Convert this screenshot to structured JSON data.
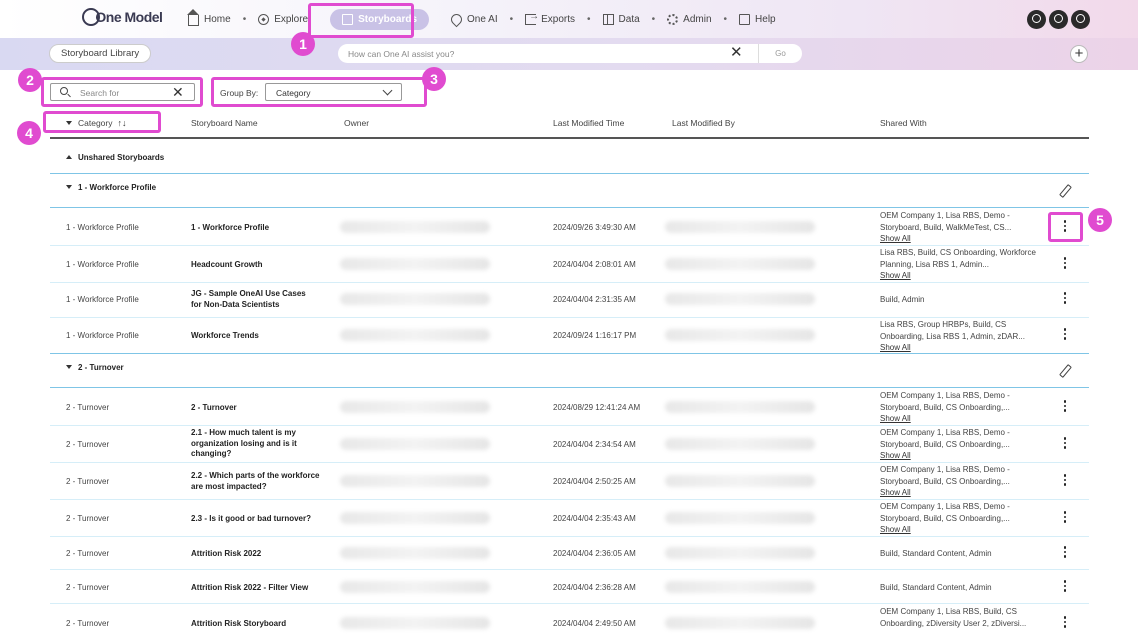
{
  "app": {
    "logo": "One Model"
  },
  "nav": [
    {
      "label": "Home",
      "icon": "home-icon"
    },
    {
      "label": "Explore",
      "icon": "compass-icon"
    },
    {
      "label": "Storyboards",
      "icon": "storyboard-icon",
      "active": true
    },
    {
      "label": "One AI",
      "icon": "pin-icon"
    },
    {
      "label": "Exports",
      "icon": "export-icon"
    },
    {
      "label": "Data",
      "icon": "data-icon"
    },
    {
      "label": "Admin",
      "icon": "gear-icon"
    },
    {
      "label": "Help",
      "icon": "help-icon"
    }
  ],
  "subbar": {
    "library_label": "Storyboard Library",
    "ai_placeholder": "How can One AI assist you?",
    "go_label": "Go"
  },
  "filters": {
    "search_placeholder": "Search for",
    "group_by_label": "Group By:",
    "group_by_value": "Category"
  },
  "columns": {
    "category": "Category",
    "name": "Storyboard Name",
    "owner": "Owner",
    "modified_time": "Last Modified Time",
    "modified_by": "Last Modified By",
    "shared_with": "Shared With"
  },
  "groups": {
    "unshared": "Unshared Storyboards",
    "workforce": "1 - Workforce Profile",
    "turnover": "2 - Turnover"
  },
  "show_all": "Show All",
  "rows": [
    {
      "category": "1 - Workforce Profile",
      "name": "1 - Workforce Profile",
      "time": "2024/09/26 3:49:30 AM",
      "shared": "OEM Company 1, Lisa RBS, Demo - Storyboard, Build, WalkMeTest, CS...",
      "show_all": true
    },
    {
      "category": "1 - Workforce Profile",
      "name": "Headcount Growth",
      "time": "2024/04/04 2:08:01 AM",
      "shared": "Lisa RBS, Build, CS Onboarding, Workforce Planning, Lisa RBS 1, Admin...",
      "show_all": true
    },
    {
      "category": "1 - Workforce Profile",
      "name": "JG - Sample OneAI Use Cases for Non-Data Scientists",
      "time": "2024/04/04 2:31:35 AM",
      "shared": "Build, Admin",
      "show_all": false
    },
    {
      "category": "1 - Workforce Profile",
      "name": "Workforce Trends",
      "time": "2024/09/24 1:16:17 PM",
      "shared": "Lisa RBS, Group HRBPs, Build, CS Onboarding, Lisa RBS 1, Admin, zDAR...",
      "show_all": true
    },
    {
      "category": "2 - Turnover",
      "name": "2 - Turnover",
      "time": "2024/08/29 12:41:24 AM",
      "shared": "OEM Company 1, Lisa RBS, Demo - Storyboard, Build, CS Onboarding,...",
      "show_all": true
    },
    {
      "category": "2 - Turnover",
      "name": "2.1 - How much talent is my organization losing and is it changing?",
      "time": "2024/04/04 2:34:54 AM",
      "shared": "OEM Company 1, Lisa RBS, Demo - Storyboard, Build, CS Onboarding,...",
      "show_all": true
    },
    {
      "category": "2 - Turnover",
      "name": "2.2 - Which parts of the workforce are most impacted?",
      "time": "2024/04/04 2:50:25 AM",
      "shared": "OEM Company 1, Lisa RBS, Demo - Storyboard, Build, CS Onboarding,...",
      "show_all": true
    },
    {
      "category": "2 - Turnover",
      "name": "2.3 - Is it good or bad turnover?",
      "time": "2024/04/04 2:35:43 AM",
      "shared": "OEM Company 1, Lisa RBS, Demo - Storyboard, Build, CS Onboarding,...",
      "show_all": true
    },
    {
      "category": "2 - Turnover",
      "name": "Attrition Risk 2022",
      "time": "2024/04/04 2:36:05 AM",
      "shared": "Build, Standard Content, Admin",
      "show_all": false
    },
    {
      "category": "2 - Turnover",
      "name": "Attrition Risk 2022 - Filter View",
      "time": "2024/04/04 2:36:28 AM",
      "shared": "Build, Standard Content, Admin",
      "show_all": false
    },
    {
      "category": "2 - Turnover",
      "name": "Attrition Risk Storyboard",
      "time": "2024/04/04 2:49:50 AM",
      "shared": "OEM Company 1, Lisa RBS, Build, CS Onboarding, zDiversity User 2, zDiversi...",
      "show_all": true
    }
  ],
  "callouts": [
    "1",
    "2",
    "3",
    "4",
    "5"
  ],
  "colors": {
    "accent": "#e04bd0",
    "divider": "#7fc5e6",
    "active_nav": "#c9c2e6"
  }
}
